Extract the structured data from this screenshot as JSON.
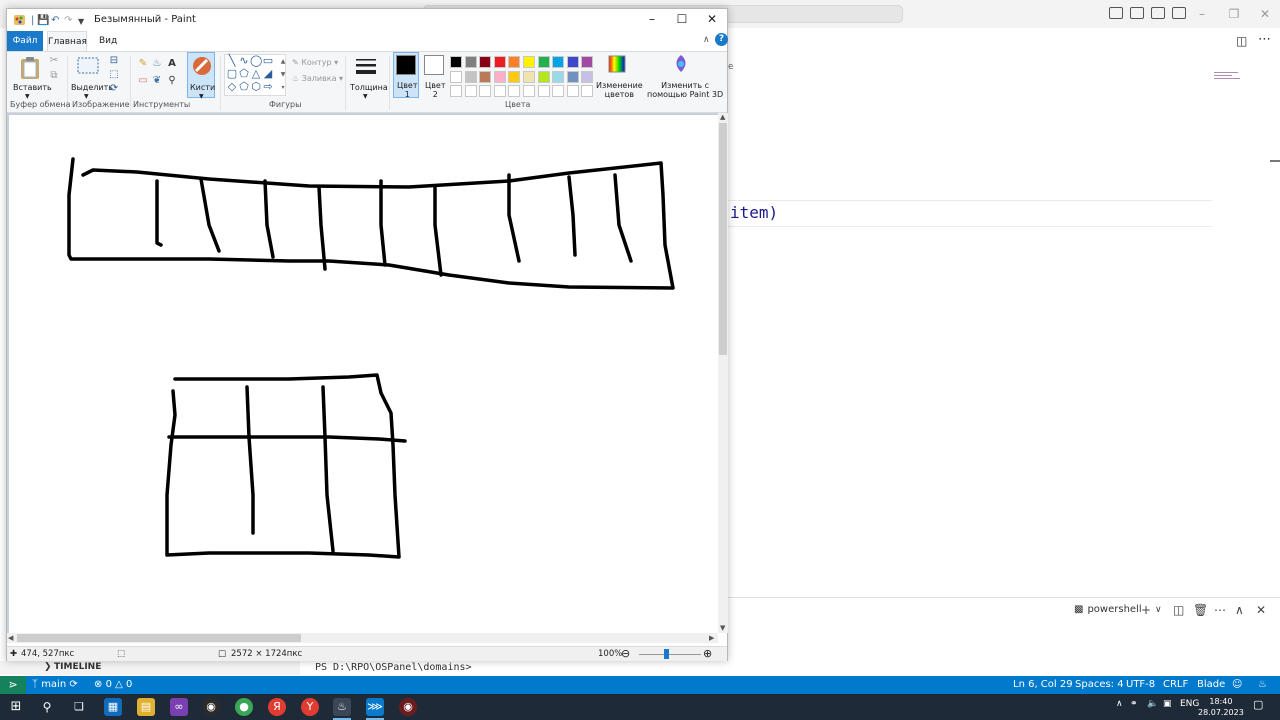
{
  "vscode": {
    "code_fragment": "item)",
    "code_fragment_small": "e",
    "terminal": {
      "shell_label": "powershell",
      "prompt": "PS D:\\RPO\\OSPanel\\domains>"
    },
    "timeline_label": "TIMELINE",
    "statusbar": {
      "branch": "main",
      "problems": "0",
      "warnings": "0",
      "cursor": "Ln 6, Col 29",
      "spaces": "Spaces: 4",
      "encoding": "UTF-8",
      "eol": "CRLF",
      "language": "Blade"
    }
  },
  "paint": {
    "title": "Безымянный - Paint",
    "tabs": {
      "file": "Файл",
      "home": "Главная",
      "view": "Вид"
    },
    "ribbon": {
      "paste": "Вставить",
      "select": "Выделить",
      "brushes": "Кисти",
      "outline": "Контур",
      "fill": "Заливка",
      "thickness": "Толщина",
      "color1_line1": "Цвет",
      "color1_line2": "1",
      "color2_line1": "Цвет",
      "color2_line2": "2",
      "edit_colors_line1": "Изменение",
      "edit_colors_line2": "цветов",
      "paint3d_line1": "Изменить с",
      "paint3d_line2": "помощью Paint 3D",
      "groups": {
        "clipboard": "Буфер обмена",
        "image": "Изображение",
        "tools": "Инструменты",
        "shapes": "Фигуры",
        "colors": "Цвета"
      }
    },
    "palette_row1": [
      "#000000",
      "#7f7f7f",
      "#880015",
      "#ed1c24",
      "#ff7f27",
      "#fff200",
      "#22b14c",
      "#00a2e8",
      "#3f48cc",
      "#a349a4"
    ],
    "palette_row2": [
      "#ffffff",
      "#c3c3c3",
      "#b97a57",
      "#ffaec9",
      "#ffc90e",
      "#efe4b0",
      "#b5e61d",
      "#99d9ea",
      "#7092be",
      "#c8bfe7"
    ],
    "color1": "#000000",
    "color2": "#ffffff",
    "status": {
      "cursor_pos": "474, 527пкс",
      "image_size": "2572 × 1724пкс",
      "zoom": "100%"
    }
  },
  "taskbar": {
    "lang": "ENG",
    "time": "18:40",
    "date": "28.07.2023"
  }
}
